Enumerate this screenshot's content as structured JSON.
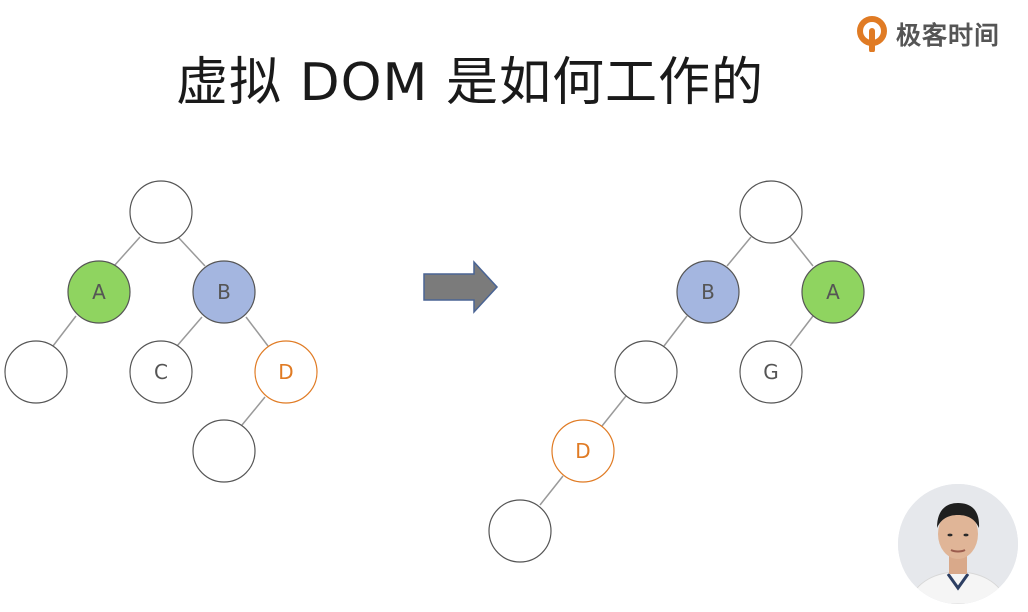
{
  "header": {
    "title": "虚拟 DOM 是如何工作的",
    "logo_text": "极客时间",
    "logo_icon": "geektime-logo-icon"
  },
  "colors": {
    "accent_orange": "#e07b24",
    "node_green": "#8fd460",
    "node_blue": "#a4b6e0",
    "arrow_gray": "#7b7b7b",
    "arrow_border": "#4a6494",
    "edge": "#9a9a9a"
  },
  "diagram": {
    "left_tree": {
      "nodes": [
        {
          "id": "root",
          "label": ""
        },
        {
          "id": "a",
          "label": "A"
        },
        {
          "id": "b",
          "label": "B"
        },
        {
          "id": "a-child",
          "label": ""
        },
        {
          "id": "c",
          "label": "C"
        },
        {
          "id": "d",
          "label": "D"
        },
        {
          "id": "d-child",
          "label": ""
        }
      ]
    },
    "right_tree": {
      "nodes": [
        {
          "id": "root",
          "label": ""
        },
        {
          "id": "b",
          "label": "B"
        },
        {
          "id": "a",
          "label": "A"
        },
        {
          "id": "b-child",
          "label": ""
        },
        {
          "id": "g",
          "label": "G"
        },
        {
          "id": "d",
          "label": "D"
        },
        {
          "id": "d-child",
          "label": ""
        }
      ]
    },
    "arrow_icon": "right-arrow-icon"
  }
}
